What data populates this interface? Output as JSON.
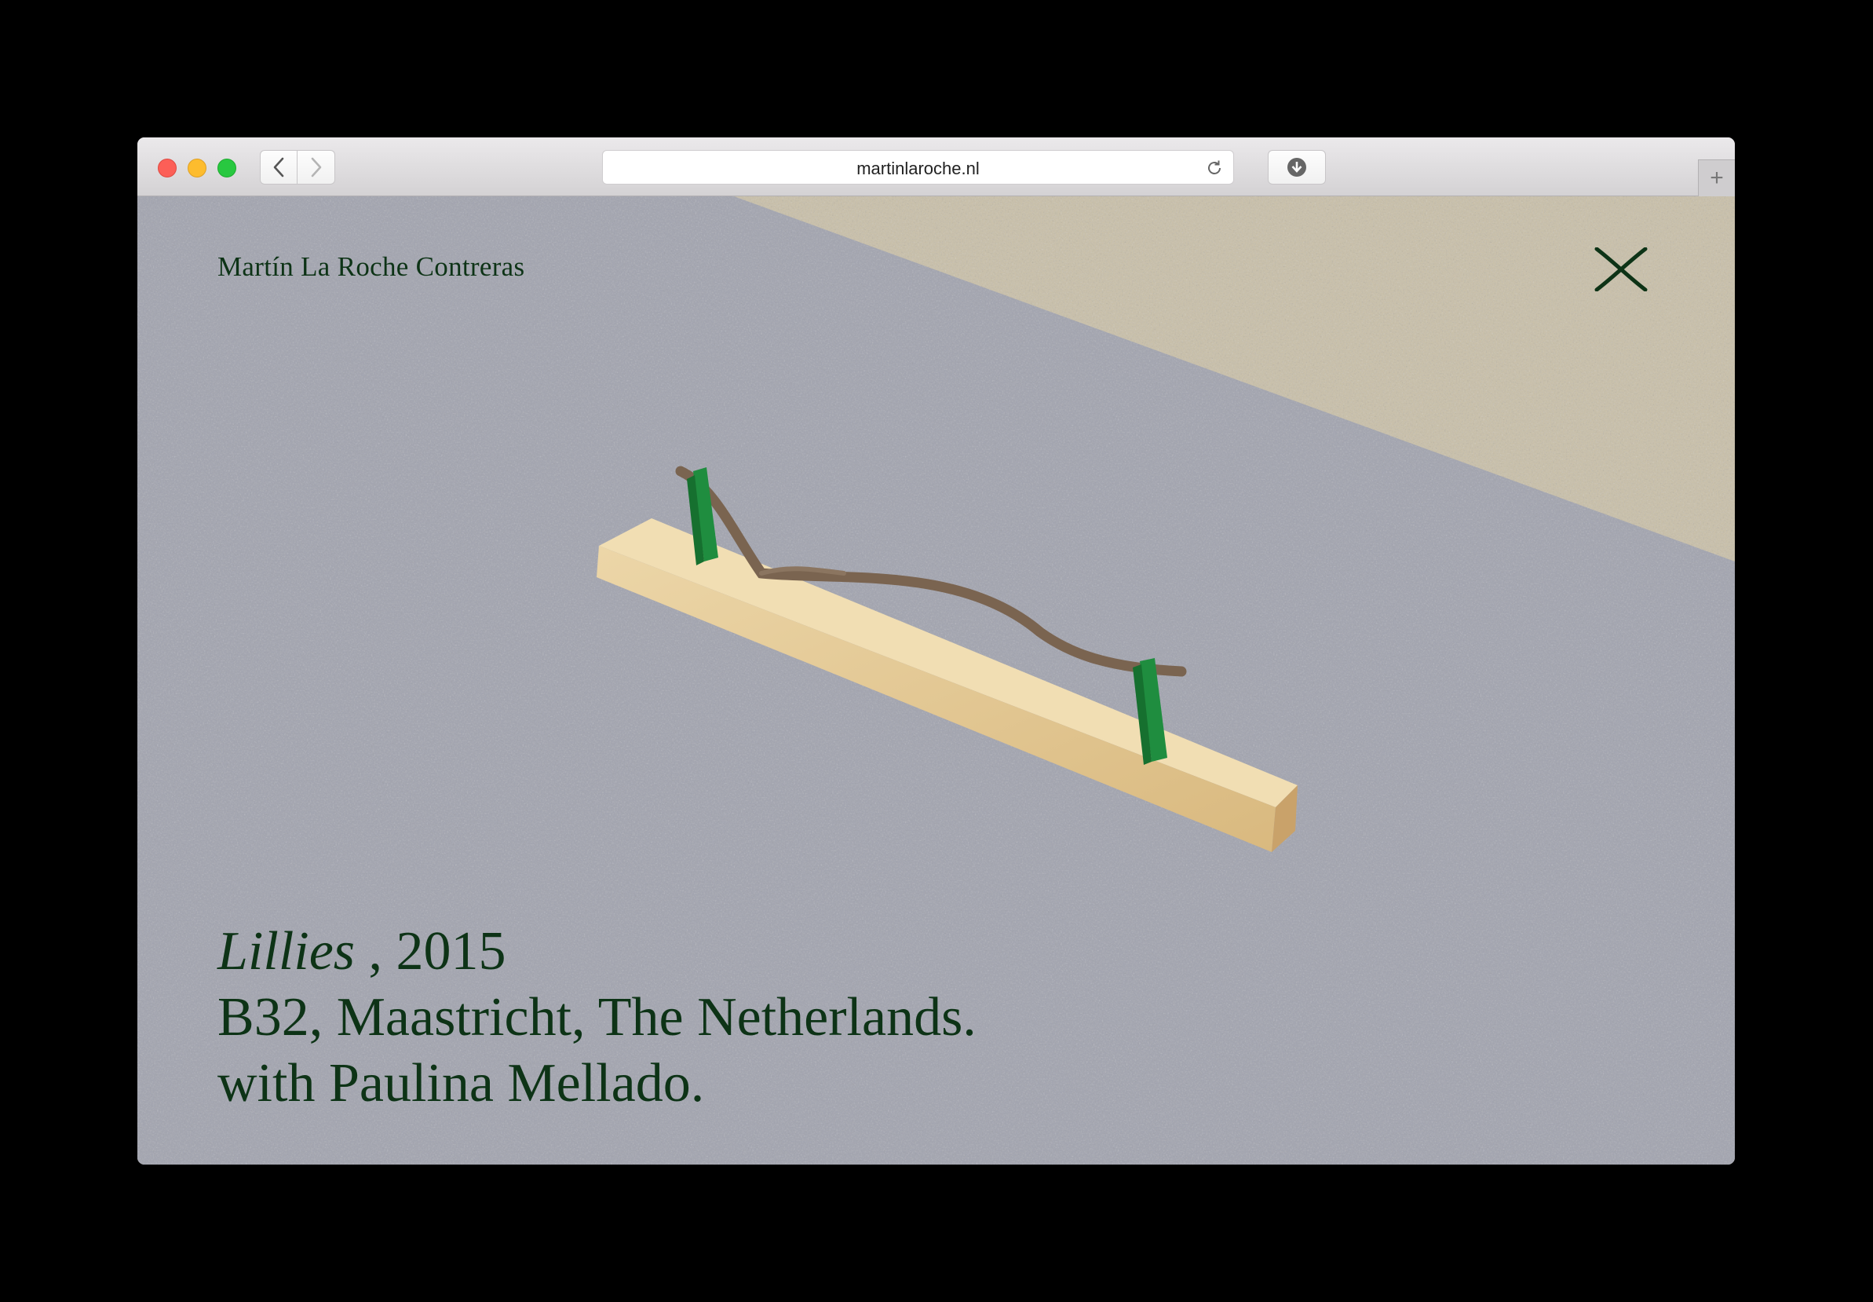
{
  "browser": {
    "url": "martinlaroche.nl",
    "icons": {
      "back": "chevron-left-icon",
      "forward": "chevron-right-icon",
      "reload": "reload-icon",
      "download": "download-icon",
      "new_tab": "plus-icon"
    },
    "new_tab_glyph": "+"
  },
  "site": {
    "name": "Martín La Roche Contreras",
    "close_icon": "close-icon",
    "accent_color": "#0d3316"
  },
  "artwork": {
    "title": "Lillies",
    "year": " , 2015",
    "location": "B32, Maastricht, The Netherlands.",
    "collaboration": "with Paulina Mellado."
  }
}
